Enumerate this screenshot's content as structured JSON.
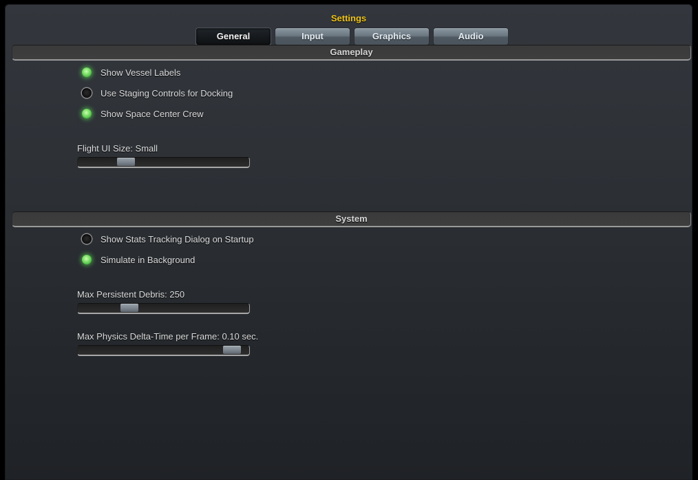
{
  "window": {
    "title": "Settings"
  },
  "tabs": [
    {
      "label": "General",
      "active": true
    },
    {
      "label": "Input",
      "active": false
    },
    {
      "label": "Graphics",
      "active": false
    },
    {
      "label": "Audio",
      "active": false
    }
  ],
  "sections": {
    "gameplay": {
      "title": "Gameplay",
      "toggles": [
        {
          "label": "Show Vessel Labels",
          "checked": true
        },
        {
          "label": "Use Staging Controls for Docking",
          "checked": false
        },
        {
          "label": "Show Space Center Crew",
          "checked": true
        }
      ],
      "sliders": [
        {
          "label": "Flight UI Size: Small",
          "value_fraction": 0.28
        }
      ]
    },
    "system": {
      "title": "System",
      "toggles": [
        {
          "label": "Show Stats Tracking Dialog on Startup",
          "checked": false
        },
        {
          "label": "Simulate in Background",
          "checked": true
        }
      ],
      "sliders": [
        {
          "label": "Max Persistent Debris: 250",
          "value_fraction": 0.3
        },
        {
          "label": "Max Physics Delta-Time per Frame: 0.10 sec.",
          "value_fraction": 0.9
        }
      ]
    }
  },
  "colors": {
    "title": "#f0c419",
    "led_on": "#7fe06a",
    "led_off": "#151515"
  }
}
